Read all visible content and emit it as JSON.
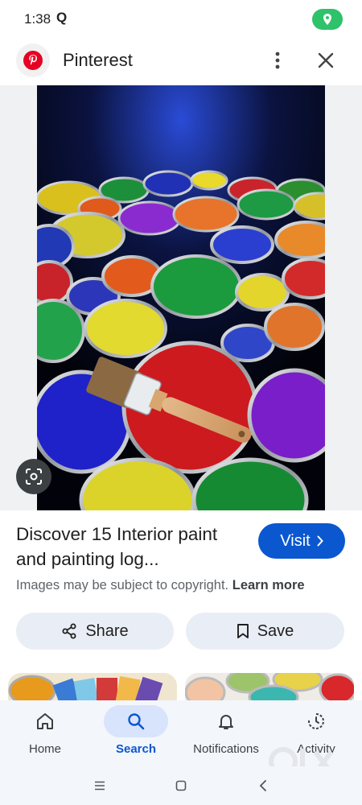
{
  "status_bar": {
    "time": "1:38",
    "search_glyph": "Q",
    "location_icon": "location-pin-icon",
    "pill_color": "#2ec26a"
  },
  "header": {
    "source_name": "Pinterest",
    "logo_icon": "pinterest-logo-icon",
    "brand_color": "#e60023"
  },
  "image": {
    "subject": "paint cans with brush"
  },
  "result": {
    "title": "Discover 15 Interior paint and painting log...",
    "visit_label": "Visit",
    "copyright_text": "Images may be subject to copyright.",
    "learn_more": "Learn more"
  },
  "actions": {
    "share_label": "Share",
    "save_label": "Save"
  },
  "bottom_nav": {
    "items": [
      {
        "label": "Home",
        "icon": "home-icon",
        "active": false
      },
      {
        "label": "Search",
        "icon": "search-icon",
        "active": true
      },
      {
        "label": "Notifications",
        "icon": "bell-icon",
        "active": false
      },
      {
        "label": "Activity",
        "icon": "activity-icon",
        "active": false
      }
    ]
  },
  "colors": {
    "accent": "#0b57d0",
    "chip_bg": "#e9eef6",
    "nav_bg": "#f3f6fb"
  },
  "watermark": {
    "text": "OLX"
  }
}
